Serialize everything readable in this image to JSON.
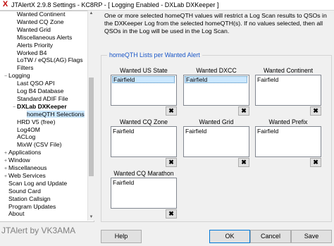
{
  "window": {
    "title": "JTAlertX 2.9.8 Settings  -  KC8RP  -  [ Logging Enabled - DXLab DXKeeper ]",
    "app_icon": "jtalert-x-icon"
  },
  "tree": {
    "items": [
      {
        "label": "Wanted Continent",
        "twisty": "",
        "depth": 2
      },
      {
        "label": "Wanted CQ Zone",
        "twisty": "",
        "depth": 2
      },
      {
        "label": "Wanted Grid",
        "twisty": "",
        "depth": 2
      },
      {
        "label": "Miscellaneous Alerts",
        "twisty": "",
        "depth": 2
      },
      {
        "label": "Alerts Priority",
        "twisty": "",
        "depth": 2
      },
      {
        "label": "Worked B4",
        "twisty": "",
        "depth": 2
      },
      {
        "label": "LoTW / eQSL(AG) Flags",
        "twisty": "",
        "depth": 2
      },
      {
        "label": "Filters",
        "twisty": "",
        "depth": 2
      },
      {
        "label": "Logging",
        "twisty": "−",
        "depth": 1
      },
      {
        "label": "Last QSO API",
        "twisty": "",
        "depth": 2
      },
      {
        "label": "Log B4 Database",
        "twisty": "",
        "depth": 2
      },
      {
        "label": "Standard ADIF File",
        "twisty": "",
        "depth": 2
      },
      {
        "label": "DXLab DXKeeper",
        "twisty": "−",
        "depth": 2,
        "bold": true
      },
      {
        "label": "homeQTH Selections",
        "twisty": "",
        "depth": 3,
        "selected": true
      },
      {
        "label": "HRD V5 (free)",
        "twisty": "",
        "depth": 2
      },
      {
        "label": "Log4OM",
        "twisty": "",
        "depth": 2
      },
      {
        "label": "ACLog",
        "twisty": "",
        "depth": 2
      },
      {
        "label": "MixW (CSV File)",
        "twisty": "",
        "depth": 2
      },
      {
        "label": "Applications",
        "twisty": "+",
        "depth": 1
      },
      {
        "label": "Window",
        "twisty": "+",
        "depth": 1
      },
      {
        "label": "Miscellaneous",
        "twisty": "+",
        "depth": 1
      },
      {
        "label": "Web Services",
        "twisty": "+",
        "depth": 1
      },
      {
        "label": "Scan Log and Update",
        "twisty": "",
        "depth": 1
      },
      {
        "label": "Sound Card",
        "twisty": "",
        "depth": 1
      },
      {
        "label": "Station Callsign",
        "twisty": "",
        "depth": 1
      },
      {
        "label": "Program Updates",
        "twisty": "",
        "depth": 1
      },
      {
        "label": "About",
        "twisty": "",
        "depth": 1
      }
    ]
  },
  "footer_label": "JTAlert by VK3AMA",
  "info_text": "One or more selected homeQTH values will restrict a Log Scan results to QSOs in the DXKeeper Log from the selected homeQTH(s). If no values selected, then all QSOs in the Log will be used in the Log Scan.",
  "group": {
    "title": "homeQTH Lists per Wanted Alert",
    "lists": [
      {
        "label": "Wanted US State",
        "value": "Fairfield",
        "selected": true,
        "delete": "✖"
      },
      {
        "label": "Wanted DXCC",
        "value": "Fairfield",
        "selected": true,
        "delete": "✖"
      },
      {
        "label": "Wanted Continent",
        "value": "Fairfield",
        "selected": false,
        "delete": "✖"
      },
      {
        "label": "Wanted CQ Zone",
        "value": "Fairfield",
        "selected": false,
        "delete": "✖"
      },
      {
        "label": "Wanted Grid",
        "value": "Fairfield",
        "selected": false,
        "delete": "✖"
      },
      {
        "label": "Wanted Prefix",
        "value": "Fairfield",
        "selected": false,
        "delete": "✖"
      },
      {
        "label": "Wanted CQ Marathon",
        "value": "Fairfield",
        "selected": false,
        "delete": "✖"
      }
    ]
  },
  "buttons": {
    "help": "Help",
    "ok": "OK",
    "cancel": "Cancel",
    "save": "Save"
  }
}
